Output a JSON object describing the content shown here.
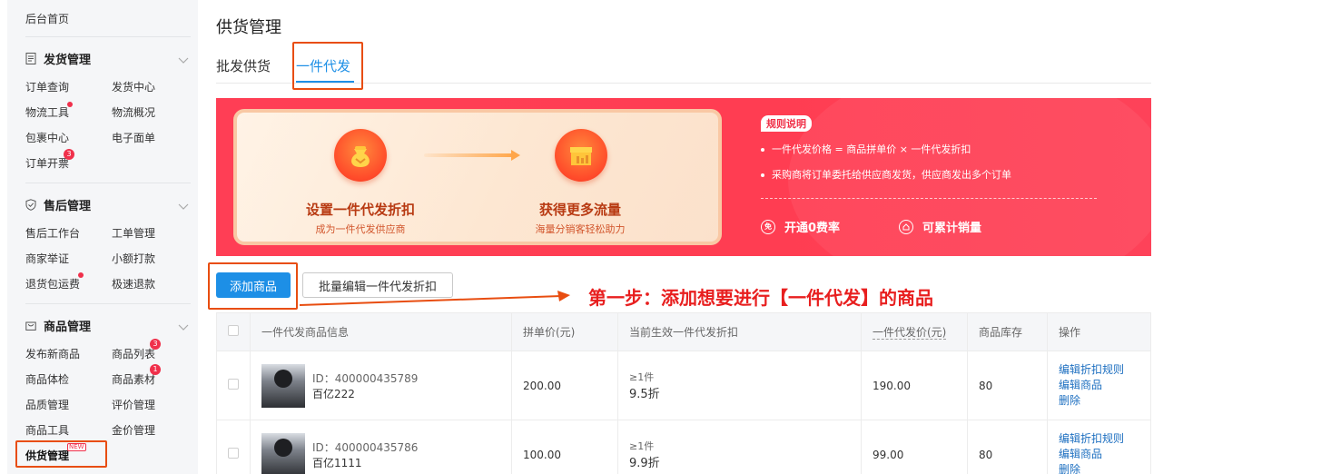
{
  "sidebar": {
    "home": "后台首页",
    "sections": [
      {
        "title": "发货管理",
        "icon": "document-icon",
        "items": [
          "订单查询",
          "发货中心",
          "物流工具",
          "物流概况",
          "包裹中心",
          "电子面单",
          "订单开票"
        ]
      },
      {
        "title": "售后管理",
        "icon": "shield-check-icon",
        "items": [
          "售后工作台",
          "工单管理",
          "商家举证",
          "小额打款",
          "退货包运费",
          "极速退款"
        ]
      },
      {
        "title": "商品管理",
        "icon": "shopping-bag-icon",
        "items": [
          "发布新商品",
          "商品列表",
          "商品体检",
          "商品素材",
          "品质管理",
          "评价管理",
          "商品工具",
          "金价管理",
          "供货管理"
        ]
      }
    ],
    "badges": {
      "invoice": "3",
      "product_list": "3",
      "product_material": "1",
      "new_tag": "NEW"
    }
  },
  "page": {
    "title": "供货管理",
    "tabs": [
      {
        "label": "批发供货"
      },
      {
        "label": "一件代发"
      }
    ]
  },
  "banner": {
    "step1_title": "设置一件代发折扣",
    "step1_sub": "成为一件代发供应商",
    "step2_title": "获得更多流量",
    "step2_sub": "海量分销客轻松助力",
    "rules_badge": "规则说明",
    "rule1": "一件代发价格 = 商品拼单价 × 一件代发折扣",
    "rule2": "采购商将订单委托给供应商发货，供应商发出多个订单",
    "perk1": "开通0费率",
    "perk1_icon_text": "免",
    "perk2": "可累计销量"
  },
  "actions": {
    "add_product": "添加商品",
    "batch_edit": "批量编辑一件代发折扣"
  },
  "annotation": "第一步：添加想要进行【一件代发】的商品",
  "table": {
    "headers": [
      "一件代发商品信息",
      "拼单价(元)",
      "当前生效一件代发折扣",
      "一件代发价(元)",
      "商品库存",
      "操作"
    ],
    "rows": [
      {
        "id": "ID：400000435789",
        "name": "百亿222",
        "price": "200.00",
        "disc_cond": "≥1件",
        "disc": "9.5折",
        "final": "190.00",
        "stock": "80",
        "ops": [
          "编辑折扣规则",
          "编辑商品",
          "删除"
        ]
      },
      {
        "id": "ID：400000435786",
        "name": "百亿1111",
        "price": "100.00",
        "disc_cond": "≥1件",
        "disc": "9.9折",
        "final": "99.00",
        "stock": "80",
        "ops": [
          "编辑折扣规则",
          "编辑商品",
          "删除"
        ]
      }
    ]
  },
  "colors": {
    "accent": "#1d8fe6",
    "banner_red": "#ff3e55",
    "annotation": "#e81f1f",
    "highlight": "#e84d10"
  }
}
